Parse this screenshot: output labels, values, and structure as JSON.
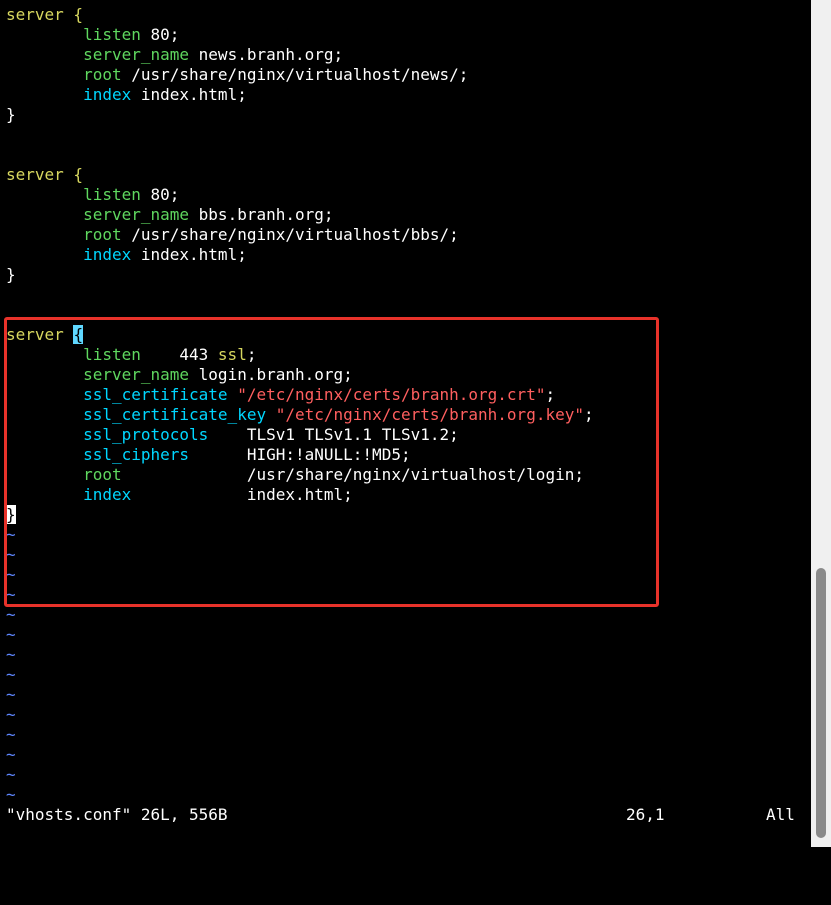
{
  "editor": {
    "lines": [
      [
        {
          "t": "server {",
          "c": "kw"
        }
      ],
      [
        {
          "t": "        "
        },
        {
          "t": "listen",
          "c": "dir"
        },
        {
          "t": " 80;"
        }
      ],
      [
        {
          "t": "        "
        },
        {
          "t": "server_name",
          "c": "dir"
        },
        {
          "t": " news.branh.org;"
        }
      ],
      [
        {
          "t": "        "
        },
        {
          "t": "root",
          "c": "dir"
        },
        {
          "t": " /usr/share/nginx/virtualhost/news/;"
        }
      ],
      [
        {
          "t": "        "
        },
        {
          "t": "index",
          "c": "dir2"
        },
        {
          "t": " index.html;"
        }
      ],
      [
        {
          "t": "}"
        }
      ],
      [],
      [],
      [
        {
          "t": "server {",
          "c": "kw"
        }
      ],
      [
        {
          "t": "        "
        },
        {
          "t": "listen",
          "c": "dir"
        },
        {
          "t": " 80;"
        }
      ],
      [
        {
          "t": "        "
        },
        {
          "t": "server_name",
          "c": "dir"
        },
        {
          "t": " bbs.branh.org;"
        }
      ],
      [
        {
          "t": "        "
        },
        {
          "t": "root",
          "c": "dir"
        },
        {
          "t": " /usr/share/nginx/virtualhost/bbs/;"
        }
      ],
      [
        {
          "t": "        "
        },
        {
          "t": "index",
          "c": "dir2"
        },
        {
          "t": " index.html;"
        }
      ],
      [
        {
          "t": "}"
        }
      ],
      [],
      [],
      [
        {
          "t": "server ",
          "c": "kw"
        },
        {
          "t": "{",
          "c": "cursor-brace"
        }
      ],
      [
        {
          "t": "        "
        },
        {
          "t": "listen",
          "c": "dir"
        },
        {
          "t": "    443 "
        },
        {
          "t": "ssl",
          "c": "kw"
        },
        {
          "t": ";"
        }
      ],
      [
        {
          "t": "        "
        },
        {
          "t": "server_name",
          "c": "dir"
        },
        {
          "t": " login.branh.org;"
        }
      ],
      [
        {
          "t": "        "
        },
        {
          "t": "ssl_certificate",
          "c": "dir2"
        },
        {
          "t": " "
        },
        {
          "t": "\"/etc/nginx/certs/branh.org.crt\"",
          "c": "str"
        },
        {
          "t": ";"
        }
      ],
      [
        {
          "t": "        "
        },
        {
          "t": "ssl_certificate_key",
          "c": "dir2"
        },
        {
          "t": " "
        },
        {
          "t": "\"/etc/nginx/certs/branh.org.key\"",
          "c": "str"
        },
        {
          "t": ";"
        }
      ],
      [
        {
          "t": "        "
        },
        {
          "t": "ssl_protocols",
          "c": "dir2"
        },
        {
          "t": "    TLSv1 TLSv1.1 TLSv1.2;"
        }
      ],
      [
        {
          "t": "        "
        },
        {
          "t": "ssl_ciphers",
          "c": "dir2"
        },
        {
          "t": "      HIGH:!aNULL:!MD5;"
        }
      ],
      [
        {
          "t": "        "
        },
        {
          "t": "root",
          "c": "dir"
        },
        {
          "t": "             /usr/share/nginx/virtualhost/login;"
        }
      ],
      [
        {
          "t": "        "
        },
        {
          "t": "index",
          "c": "dir2"
        },
        {
          "t": "            index.html;"
        }
      ],
      [
        {
          "t": "}",
          "c": "cursor"
        }
      ],
      [
        {
          "t": "~",
          "c": "tilde"
        }
      ],
      [
        {
          "t": "~",
          "c": "tilde"
        }
      ],
      [
        {
          "t": "~",
          "c": "tilde"
        }
      ],
      [
        {
          "t": "~",
          "c": "tilde"
        }
      ],
      [
        {
          "t": "~",
          "c": "tilde"
        }
      ],
      [
        {
          "t": "~",
          "c": "tilde"
        }
      ],
      [
        {
          "t": "~",
          "c": "tilde"
        }
      ],
      [
        {
          "t": "~",
          "c": "tilde"
        }
      ],
      [
        {
          "t": "~",
          "c": "tilde"
        }
      ],
      [
        {
          "t": "~",
          "c": "tilde"
        }
      ],
      [
        {
          "t": "~",
          "c": "tilde"
        }
      ],
      [
        {
          "t": "~",
          "c": "tilde"
        }
      ],
      [
        {
          "t": "~",
          "c": "tilde"
        }
      ],
      [
        {
          "t": "~",
          "c": "tilde"
        }
      ]
    ]
  },
  "status": {
    "file_info": "\"vhosts.conf\" 26L, 556B",
    "cursor_pos": "26,1",
    "scroll_pos": "All"
  },
  "colors": {
    "background": "#000000",
    "keyword": "#d7d75f",
    "directive": "#5fd75f",
    "directive_alt": "#00d7ff",
    "string": "#ff5f5f",
    "tilde": "#5f87ff",
    "highlight_box": "#e8322a",
    "scrollbar_track": "#f0f0f0",
    "scrollbar_thumb": "#8a8a8a"
  }
}
